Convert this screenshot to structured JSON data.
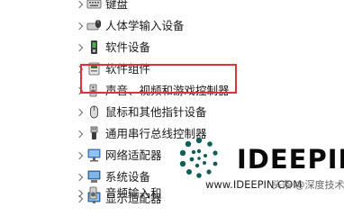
{
  "device_tree": {
    "items": [
      {
        "label": "键盘",
        "icon": "keyboard-icon"
      },
      {
        "label": "人体学输入设备",
        "icon": "hid-icon"
      },
      {
        "label": "软件设备",
        "icon": "software-device-icon"
      },
      {
        "label": "软件组件",
        "icon": "software-component-icon"
      },
      {
        "label": "声音、视频和游戏控制器",
        "icon": "speaker-icon"
      },
      {
        "label": "鼠标和其他指针设备",
        "icon": "mouse-icon"
      },
      {
        "label": "通用串行总线控制器",
        "icon": "usb-icon"
      },
      {
        "label": "网络适配器",
        "icon": "network-adapter-icon"
      },
      {
        "label": "系统设备",
        "icon": "system-device-icon"
      },
      {
        "label": "显示适配器",
        "icon": "display-adapter-icon"
      },
      {
        "label": "音频输入和",
        "icon": "audio-input-icon"
      }
    ],
    "highlighted_index": 4,
    "highlight_color": "#e03232"
  },
  "watermark": {
    "brand": "IDEEPIN",
    "url": "www.IDEEPIN.COM",
    "author": "头条 @深度技术"
  }
}
